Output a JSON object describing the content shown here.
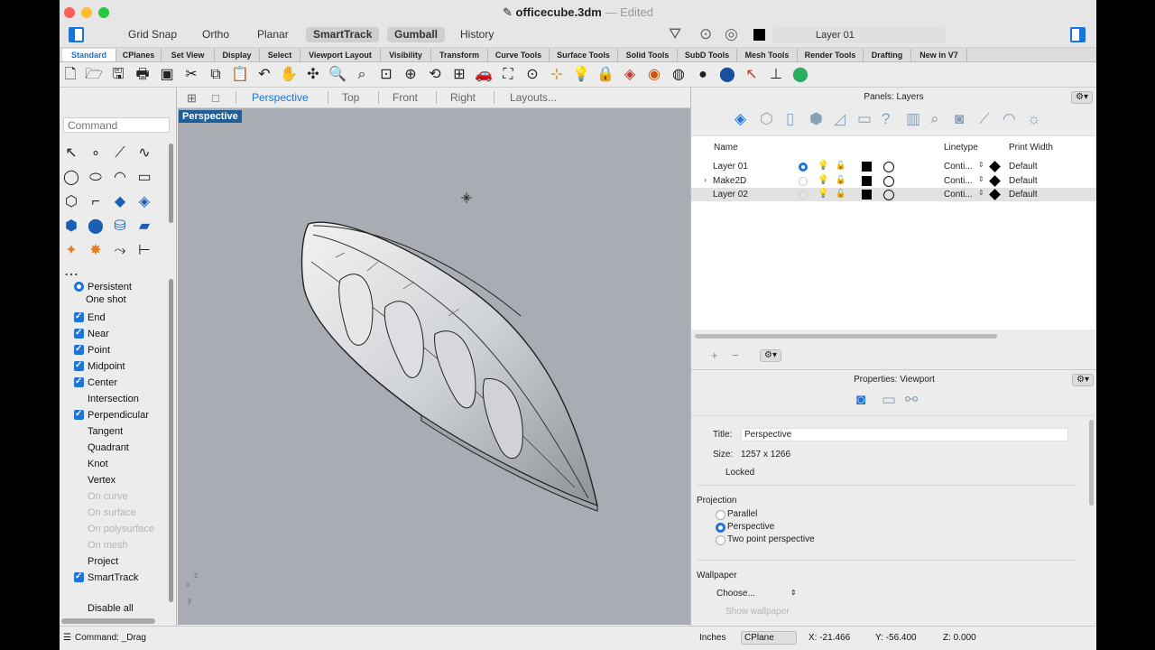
{
  "window": {
    "file_name": "officecube.3dm",
    "separator": "—",
    "edited": "Edited"
  },
  "toolbar": {
    "modes": [
      {
        "label": "Grid Snap",
        "on": false
      },
      {
        "label": "Ortho",
        "on": false
      },
      {
        "label": "Planar",
        "on": false
      },
      {
        "label": "SmartTrack",
        "on": true
      },
      {
        "label": "Gumball",
        "on": true
      },
      {
        "label": "History",
        "on": false
      }
    ],
    "current_layer": "Layer 01",
    "layer_color": "#000000"
  },
  "tabs": [
    "Standard",
    "CPlanes",
    "Set View",
    "Display",
    "Select",
    "Viewport Layout",
    "Visibility",
    "Transform",
    "Curve Tools",
    "Surface Tools",
    "Solid Tools",
    "SubD Tools",
    "Mesh Tools",
    "Render Tools",
    "Drafting",
    "New in V7"
  ],
  "active_tab": "Standard",
  "command": {
    "placeholder": "Command"
  },
  "osnap": {
    "mode": [
      {
        "label": "Persistent",
        "selected": true
      },
      {
        "label": "One shot",
        "selected": false
      }
    ],
    "items": [
      {
        "label": "End",
        "checked": true,
        "enabled": true
      },
      {
        "label": "Near",
        "checked": true,
        "enabled": true
      },
      {
        "label": "Point",
        "checked": true,
        "enabled": true
      },
      {
        "label": "Midpoint",
        "checked": true,
        "enabled": true
      },
      {
        "label": "Center",
        "checked": true,
        "enabled": true
      },
      {
        "label": "Intersection",
        "checked": false,
        "enabled": true
      },
      {
        "label": "Perpendicular",
        "checked": true,
        "enabled": true
      },
      {
        "label": "Tangent",
        "checked": false,
        "enabled": true
      },
      {
        "label": "Quadrant",
        "checked": false,
        "enabled": true
      },
      {
        "label": "Knot",
        "checked": false,
        "enabled": true
      },
      {
        "label": "Vertex",
        "checked": false,
        "enabled": true
      },
      {
        "label": "On curve",
        "checked": false,
        "enabled": false
      },
      {
        "label": "On surface",
        "checked": false,
        "enabled": false
      },
      {
        "label": "On polysurface",
        "checked": false,
        "enabled": false
      },
      {
        "label": "On mesh",
        "checked": false,
        "enabled": false
      },
      {
        "label": "Project",
        "checked": false,
        "enabled": true
      },
      {
        "label": "SmartTrack",
        "checked": true,
        "enabled": true
      },
      {
        "label": "Disable all",
        "checked": false,
        "enabled": true
      }
    ]
  },
  "viewport_tabs": {
    "perspective": "Perspective",
    "top": "Top",
    "front": "Front",
    "right": "Right",
    "layouts": "Layouts..."
  },
  "viewport": {
    "label": "Perspective",
    "axis_z": "z",
    "axis_x": "x",
    "axis_y": "y"
  },
  "layers_panel": {
    "title": "Panels: Layers",
    "columns": {
      "name": "Name",
      "linetype": "Linetype",
      "print_width": "Print Width"
    },
    "rows": [
      {
        "name": "Layer 01",
        "current": true,
        "expandable": false,
        "linetype": "Conti...",
        "print_width": "Default",
        "selected": false
      },
      {
        "name": "Make2D",
        "current": false,
        "expandable": true,
        "linetype": "Conti...",
        "print_width": "Default",
        "selected": false
      },
      {
        "name": "Layer 02",
        "current": false,
        "expandable": false,
        "linetype": "Conti...",
        "print_width": "Default",
        "selected": true
      }
    ],
    "add": "+",
    "remove": "−"
  },
  "properties": {
    "title": "Properties: Viewport",
    "title_label": "Title:",
    "title_value": "Perspective",
    "size_label": "Size:",
    "size_value": "1257 x 1266",
    "locked_label": "Locked",
    "projection_heading": "Projection",
    "projection_options": [
      {
        "label": "Parallel",
        "selected": false
      },
      {
        "label": "Perspective",
        "selected": true
      },
      {
        "label": "Two point perspective",
        "selected": false
      }
    ],
    "wallpaper_heading": "Wallpaper",
    "wallpaper_choose": "Choose...",
    "show_wallpaper": "Show wallpaper"
  },
  "status": {
    "command": "Command: _Drag",
    "units": "Inches",
    "cplane": "CPlane",
    "x": "X: -21.466",
    "y": "Y: -56.400",
    "z": "Z: 0.000"
  },
  "colors": {
    "accent": "#1f74d9",
    "viewport_bg": "#a9adb3",
    "viewport_label_bg": "#1f5f97"
  }
}
